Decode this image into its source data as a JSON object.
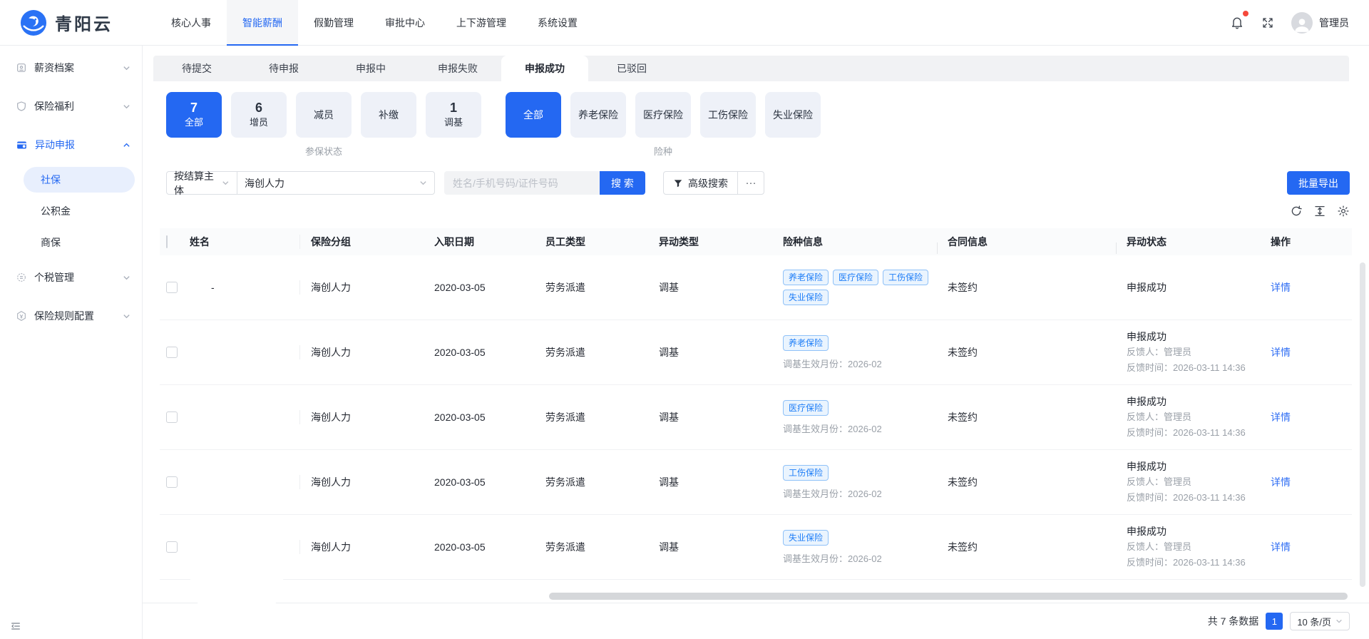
{
  "navbar": {
    "logo_text": "青阳云",
    "items": [
      {
        "label": "核心人事"
      },
      {
        "label": "智能薪酬"
      },
      {
        "label": "假勤管理"
      },
      {
        "label": "审批中心"
      },
      {
        "label": "上下游管理"
      },
      {
        "label": "系统设置"
      }
    ],
    "active_item": "智能薪酬",
    "user_name": "管理员"
  },
  "sidebar": {
    "items": [
      {
        "label": "薪资档案"
      },
      {
        "label": "保险福利"
      },
      {
        "label": "异动申报"
      },
      {
        "label": "个税管理"
      },
      {
        "label": "保险规则配置"
      }
    ],
    "active_item": "异动申报",
    "submenu": [
      {
        "label": "社保"
      },
      {
        "label": "公积金"
      },
      {
        "label": "商保"
      }
    ],
    "selected_submenu": "社保"
  },
  "tabs": [
    {
      "label": "待提交"
    },
    {
      "label": "待申报"
    },
    {
      "label": "申报中"
    },
    {
      "label": "申报失败"
    },
    {
      "label": "申报成功"
    },
    {
      "label": "已驳回"
    }
  ],
  "active_tab": "申报成功",
  "filters": {
    "status_group": {
      "group_label": "参保状态",
      "selected": "全部",
      "cards": [
        {
          "count": "7",
          "label": "全部"
        },
        {
          "count": "6",
          "label": "增员"
        },
        {
          "label": "减员"
        },
        {
          "label": "补缴"
        },
        {
          "count": "1",
          "label": "调基"
        }
      ]
    },
    "insurance_group": {
      "group_label": "险种",
      "selected": "全部",
      "cards": [
        {
          "label": "全部"
        },
        {
          "label": "养老保险"
        },
        {
          "label": "医疗保险"
        },
        {
          "label": "工伤保险"
        },
        {
          "label": "失业保险"
        }
      ]
    }
  },
  "toolbar": {
    "field_select": "按结算主体",
    "company_select": "海创人力",
    "search_placeholder": "姓名/手机号码/证件号码",
    "search_button": "搜 索",
    "advanced_search": "高级搜索",
    "more_button": "···",
    "export_button": "批量导出"
  },
  "table": {
    "headers": [
      "姓名",
      "保险分组",
      "入职日期",
      "员工类型",
      "异动类型",
      "险种信息",
      "合同信息",
      "异动状态",
      "操作"
    ],
    "rows": [
      {
        "name": "-",
        "insurance_group": "海创人力",
        "hire_date": "2020-03-05",
        "employee_type": "劳务派遣",
        "change_type": "调基",
        "badges": [
          "养老保险",
          "医疗保险",
          "工伤保险",
          "失业保险"
        ],
        "note": "",
        "contract": "未签约",
        "status": "申报成功",
        "feedback_person": "",
        "feedback_time": "",
        "action": "详情"
      },
      {
        "name": "",
        "insurance_group": "海创人力",
        "hire_date": "2020-03-05",
        "employee_type": "劳务派遣",
        "change_type": "调基",
        "badges": [
          "养老保险"
        ],
        "note": "调基生效月份：2026-02",
        "contract": "未签约",
        "status": "申报成功",
        "feedback_person": "反馈人：管理员",
        "feedback_time": "反馈时间：2026-03-11 14:36",
        "action": "详情"
      },
      {
        "name": "",
        "insurance_group": "海创人力",
        "hire_date": "2020-03-05",
        "employee_type": "劳务派遣",
        "change_type": "调基",
        "badges": [
          "医疗保险"
        ],
        "note": "调基生效月份：2026-02",
        "contract": "未签约",
        "status": "申报成功",
        "feedback_person": "反馈人：管理员",
        "feedback_time": "反馈时间：2026-03-11 14:36",
        "action": "详情"
      },
      {
        "name": "",
        "insurance_group": "海创人力",
        "hire_date": "2020-03-05",
        "employee_type": "劳务派遣",
        "change_type": "调基",
        "badges": [
          "工伤保险"
        ],
        "note": "调基生效月份：2026-02",
        "contract": "未签约",
        "status": "申报成功",
        "feedback_person": "反馈人：管理员",
        "feedback_time": "反馈时间：2026-03-11 14:36",
        "action": "详情"
      },
      {
        "name": "",
        "insurance_group": "海创人力",
        "hire_date": "2020-03-05",
        "employee_type": "劳务派遣",
        "change_type": "调基",
        "badges": [
          "失业保险"
        ],
        "note": "调基生效月份：2026-02",
        "contract": "未签约",
        "status": "申报成功",
        "feedback_person": "反馈人：管理员",
        "feedback_time": "反馈时间：2026-03-11 14:36",
        "action": "详情"
      }
    ]
  },
  "pagination": {
    "total_text": "共 7 条数据",
    "current_page": "1",
    "page_size": "10 条/页"
  },
  "icons": {
    "bell": "bell-icon",
    "fullscreen": "fullscreen-icon",
    "avatar": "user-avatar",
    "funnel": "funnel-icon",
    "refresh": "refresh-icon",
    "row_height": "row-height-icon",
    "settings": "gear-icon",
    "chevron": "chevron-down-icon",
    "collapse": "collapse-sidebar-icon"
  },
  "colors": {
    "primary": "#2468f2",
    "link": "#2f6ef4",
    "badge_text": "#1d7df7",
    "badge_bg": "#eaf4fe",
    "badge_border": "#8fc1f8",
    "sidebar_active_bg": "#e8effd",
    "notification_dot": "#f5483b",
    "tabbar_bg": "#f1f2f4",
    "card_bg": "#eef1f8"
  }
}
